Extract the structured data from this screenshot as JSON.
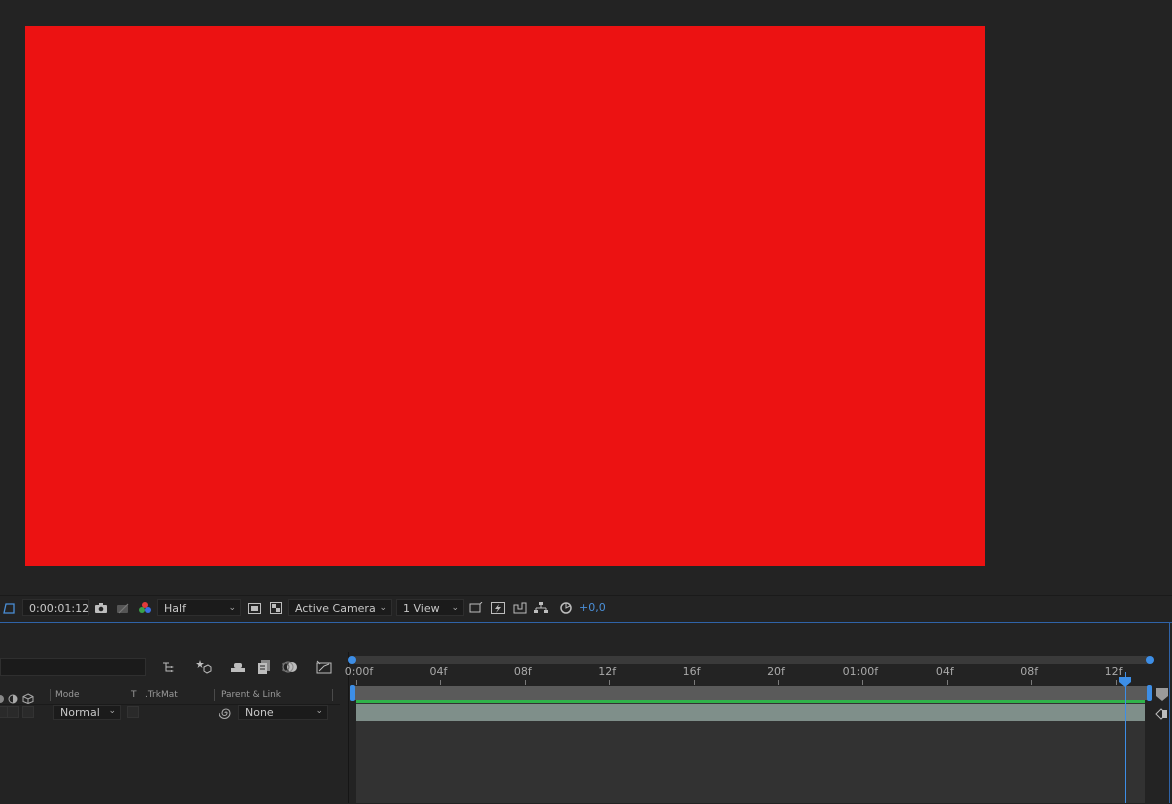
{
  "viewer": {
    "canvas_color": "#ec1212"
  },
  "viewer_toolbar": {
    "timecode": "0:00:01:12",
    "resolution": "Half",
    "view_camera": "Active Camera",
    "view_layout": "1 View",
    "exposure": "+0,0"
  },
  "timeline": {
    "columns": {
      "mode": "Mode",
      "t": "T",
      "trkmat": ".TrkMat",
      "parent": "Parent & Link"
    },
    "layer": {
      "mode": "Normal",
      "parent": "None"
    },
    "ruler_ticks": [
      "0:00f",
      "04f",
      "08f",
      "12f",
      "16f",
      "20f",
      "01:00f",
      "04f",
      "08f",
      "12f"
    ],
    "accent_color": "#3d8ee6",
    "layer_bar_color": "#7f8f8a",
    "green_line_color": "#2fb34a"
  }
}
